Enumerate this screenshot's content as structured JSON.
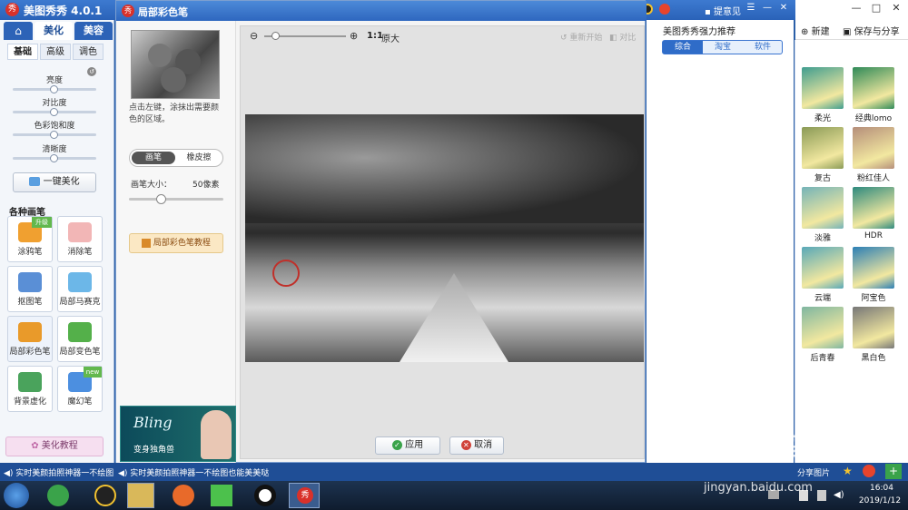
{
  "app": {
    "logo": "秀",
    "title": "美图秀秀 4.0.1"
  },
  "titlebar": {
    "login": "登录",
    "feedback": "提意见",
    "minimize": "—",
    "maximize": "□",
    "close": "✕"
  },
  "topright": {
    "new_label": "新建",
    "save_label": "保存与分享"
  },
  "left": {
    "tabs": [
      "美化",
      "美容"
    ],
    "subtabs": [
      "基础",
      "高级",
      "调色"
    ],
    "sliders": [
      {
        "label": "亮度",
        "value": 0.5
      },
      {
        "label": "对比度",
        "value": 0.5
      },
      {
        "label": "色彩饱和度",
        "value": 0.5
      },
      {
        "label": "清晰度",
        "value": 0.5
      }
    ],
    "one_click": "一键美化",
    "tools_heading": "各种画笔",
    "tools": [
      {
        "label": "涂鸦笔",
        "icon": "doodle-pen-icon",
        "color": "#f0a030",
        "badge": "升级"
      },
      {
        "label": "消除笔",
        "icon": "eraser-pen-icon",
        "color": "#f2b6b6",
        "badge": ""
      },
      {
        "label": "抠图笔",
        "icon": "cutout-pen-icon",
        "color": "#5a8fd6",
        "badge": ""
      },
      {
        "label": "局部马赛克",
        "icon": "mosaic-icon",
        "color": "#6cb7e8",
        "badge": ""
      },
      {
        "label": "局部彩色笔",
        "icon": "color-pen-icon",
        "color": "#e99a2a",
        "badge": ""
      },
      {
        "label": "局部变色笔",
        "icon": "recolor-pen-icon",
        "color": "#54b04a",
        "badge": ""
      },
      {
        "label": "背景虚化",
        "icon": "blur-bg-icon",
        "color": "#4aa35c",
        "badge": ""
      },
      {
        "label": "魔幻笔",
        "icon": "magic-pen-icon",
        "color": "#4c8fe0",
        "badge": "new"
      }
    ],
    "tutorial": "美化教程"
  },
  "dialog": {
    "logo": "秀",
    "title": "局部彩色笔",
    "instruction": "点击左键，涂抹出需要颜色的区域。",
    "brush_tab": "画笔",
    "eraser_tab": "橡皮擦",
    "brush_size_label": "画笔大小：",
    "brush_size_value": "50像素",
    "brush_size_level": 0.35,
    "tutorial_btn": "局部彩色笔教程",
    "ad_text": "Bling",
    "ad_sub": "变身独角兽",
    "zoom_ratio": "1:1",
    "zoom_label": "原大",
    "restart": "重新开始",
    "compare": "对比",
    "apply": "应用",
    "cancel": "取消"
  },
  "recommend": {
    "title": "美图秀秀强力推荐",
    "tabs": [
      "综合",
      "淘宝",
      "软件"
    ]
  },
  "effects": [
    {
      "label": "柔光",
      "color": "#3f9d8f"
    },
    {
      "label": "经典lomo",
      "color": "#2f8a58"
    },
    {
      "label": "复古",
      "color": "#8a9a56"
    },
    {
      "label": "粉红佳人",
      "color": "#b58e7a"
    },
    {
      "label": "淡雅",
      "color": "#74b3b8"
    },
    {
      "label": "HDR",
      "color": "#2e8a7e"
    },
    {
      "label": "云端",
      "color": "#58a8b8"
    },
    {
      "label": "阿宝色",
      "color": "#2c7fb5"
    },
    {
      "label": "后青春",
      "color": "#7fb6a0"
    },
    {
      "label": "黑白色",
      "color": "#777777"
    }
  ],
  "status": {
    "tip1": "实时美颜拍照神器一不绘图",
    "tip2": "实时美颜拍照神器一不绘图也能美美哒",
    "share": "分享图片"
  },
  "taskbar": {
    "time": "16:04",
    "date": "2019/1/12"
  },
  "watermark": {
    "brand": "Baidu经验",
    "url": "jingyan.baidu.com"
  }
}
